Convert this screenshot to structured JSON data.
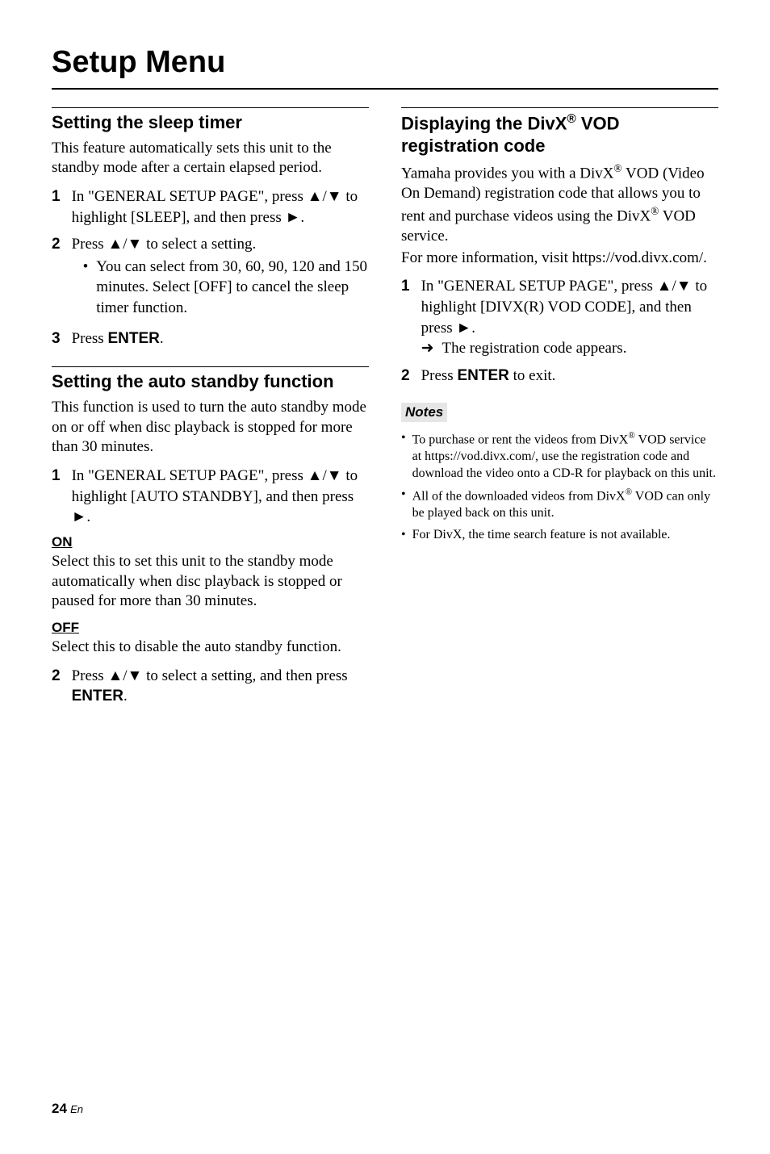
{
  "chapter": "Setup Menu",
  "left": {
    "s1": {
      "head": "Setting the sleep timer",
      "intro": "This feature automatically sets this unit to the standby mode after a certain elapsed period.",
      "step1_a": "In \"GENERAL SETUP PAGE\", press ",
      "step1_b": "/",
      "step1_c": " to highlight [SLEEP], and then press ",
      "step1_d": ".",
      "step2_a": "Press ",
      "step2_b": "/",
      "step2_c": " to select a setting.",
      "step2_bullet": "You can select from 30, 60, 90, 120 and 150 minutes. Select [OFF] to cancel the sleep timer function.",
      "step3_a": "Press ",
      "step3_b": "ENTER",
      "step3_c": "."
    },
    "s2": {
      "head": "Setting the auto standby function",
      "intro": "This function is used to turn the auto standby mode on or off when disc playback is stopped for more than 30 minutes.",
      "step1_a": "In \"GENERAL SETUP PAGE\", press ",
      "step1_b": "/",
      "step1_c": " to highlight [AUTO STANDBY], and then press ",
      "step1_d": ".",
      "on_label": "ON",
      "on_body": "Select this to set this unit to the standby mode automatically when disc playback is stopped or paused for more than 30 minutes.",
      "off_label": "OFF",
      "off_body": "Select this to disable the auto standby function.",
      "step2_a": "Press ",
      "step2_b": "/",
      "step2_c": " to select a setting, and then press ",
      "step2_d": "ENTER",
      "step2_e": "."
    }
  },
  "right": {
    "s1": {
      "head_a": "Displaying the DivX",
      "head_b": " VOD registration code",
      "intro_a": "Yamaha provides you with a DivX",
      "intro_b": " VOD (Video On Demand) registration code that allows you to rent and purchase videos using the DivX",
      "intro_c": " VOD service.",
      "intro2": "For more information, visit https://vod.divx.com/.",
      "step1_a": "In \"GENERAL SETUP PAGE\", press ",
      "step1_b": "/",
      "step1_c": " to highlight [DIVX(R) VOD CODE], and then press ",
      "step1_d": ".",
      "step1_arrow": "The registration code appears.",
      "step2_a": "Press ",
      "step2_b": "ENTER",
      "step2_c": " to exit.",
      "notes_label": "Notes",
      "note1_a": "To purchase or rent the videos from DivX",
      "note1_b": " VOD service at https://vod.divx.com/, use the registration code and download the video onto a CD-R for playback on this unit.",
      "note2_a": "All of the downloaded videos from DivX",
      "note2_b": " VOD can only be played back on this unit.",
      "note3": "For DivX, the time search feature is not available."
    }
  },
  "glyph": {
    "up": "▲",
    "down": "▼",
    "play": "►",
    "right_arrow": "➜",
    "bullet": "•",
    "reg": "®"
  },
  "footer": {
    "page": "24",
    "lang": "En"
  }
}
